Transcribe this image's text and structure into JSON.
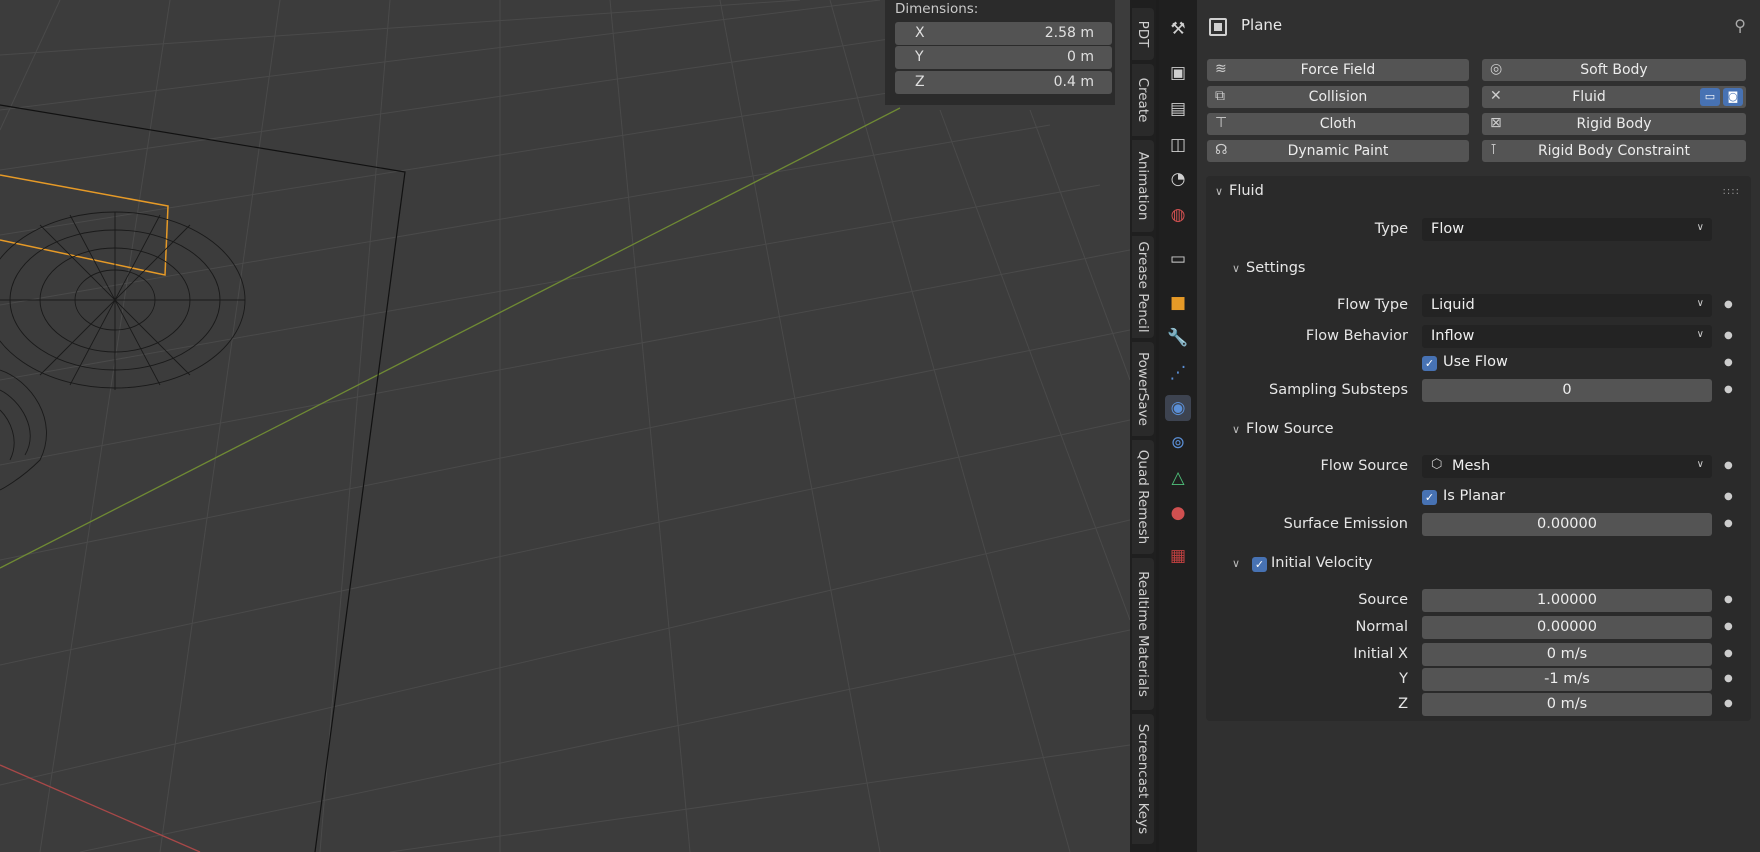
{
  "viewport": {
    "dimensions": {
      "title": "Dimensions:",
      "rows": [
        {
          "axis": "X",
          "value": "2.58 m"
        },
        {
          "axis": "Y",
          "value": "0 m"
        },
        {
          "axis": "Z",
          "value": "0.4 m"
        }
      ]
    }
  },
  "sidebar_tabs": [
    "PDT",
    "Create",
    "Animation",
    "Grease Pencil",
    "PowerSave",
    "Quad Remesh",
    "Realtime Materials",
    "Screencast Keys"
  ],
  "properties_tabs": [
    "tool-icon",
    "render-icon",
    "output-icon",
    "view-layer-icon",
    "scene-icon",
    "world-icon",
    "collection-icon",
    "object-icon",
    "modifier-icon",
    "particles-icon",
    "physics-icon",
    "constraints-icon",
    "data-icon",
    "material-icon",
    "texture-icon"
  ],
  "header": {
    "object_name": "Plane"
  },
  "physics_buttons": {
    "force_field": "Force Field",
    "soft_body": "Soft Body",
    "collision": "Collision",
    "fluid": "Fluid",
    "cloth": "Cloth",
    "rigid_body": "Rigid Body",
    "dynamic_paint": "Dynamic Paint",
    "rigid_body_constraint": "Rigid Body Constraint"
  },
  "fluid": {
    "section": "Fluid",
    "type_label": "Type",
    "type_value": "Flow",
    "settings": {
      "section": "Settings",
      "flow_type_label": "Flow Type",
      "flow_type_value": "Liquid",
      "flow_behavior_label": "Flow Behavior",
      "flow_behavior_value": "Inflow",
      "use_flow_label": "Use Flow",
      "use_flow_checked": true,
      "sampling_label": "Sampling Substeps",
      "sampling_value": "0"
    },
    "flow_source": {
      "section": "Flow Source",
      "source_label": "Flow Source",
      "source_value": "Mesh",
      "is_planar_label": "Is Planar",
      "is_planar_checked": true,
      "surface_emission_label": "Surface Emission",
      "surface_emission_value": "0.00000"
    },
    "initial_velocity": {
      "section": "Initial Velocity",
      "enabled": true,
      "source_label": "Source",
      "source_value": "1.00000",
      "normal_label": "Normal",
      "normal_value": "0.00000",
      "initial_x_label": "Initial X",
      "initial_x_value": "0 m/s",
      "y_label": "Y",
      "y_value": "-1 m/s",
      "z_label": "Z",
      "z_value": "0 m/s"
    }
  },
  "colors": {
    "accent": "#4772b3",
    "selection": "#e69a27",
    "axis_x": "#b34a4a",
    "axis_y": "#7a9a3a"
  }
}
